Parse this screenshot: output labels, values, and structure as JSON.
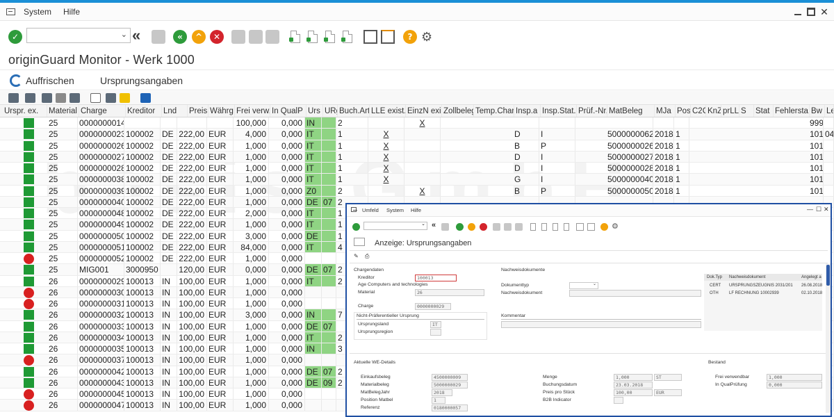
{
  "menu": {
    "items": [
      "System",
      "Hilfe"
    ]
  },
  "window": {
    "title": "originGuard Monitor - Werk 1000"
  },
  "app_toolbar": {
    "refresh_label": "Auffrischen",
    "origin_label": "Ursprungsangaben"
  },
  "columns": [
    "Urspr. ex.",
    "Material",
    "Charge",
    "Kreditor",
    "Lnd",
    "Preis",
    "Währg",
    "Frei verw.",
    "In QualP",
    "Urs",
    "URg",
    "Buch.Art",
    "LLE exist.",
    "EinzN exi.",
    "Zollbeleg",
    "Temp.Char",
    "Insp.a",
    "Insp.Stat.",
    "Prüf.-Nr.",
    "MatBeleg",
    "MJa",
    "Pos",
    "C2C",
    "KnZ",
    "prLLE",
    "S",
    "Stat",
    "Fehlersta.",
    "Bw",
    "Le"
  ],
  "rows": [
    {
      "st": "ok",
      "mat": "25",
      "ch": "0000000014",
      "kr": "",
      "lnd": "",
      "preis": "",
      "wg": "",
      "frei": "100,000",
      "qual": "0,000",
      "urs": "IN",
      "urg": "",
      "ba": "2",
      "lle": "",
      "ez": "X",
      "ia": "",
      "is": "",
      "mb": "",
      "mja": "",
      "pos": "",
      "bw": "999",
      "le": ""
    },
    {
      "st": "ok",
      "mat": "25",
      "ch": "0000000023",
      "kr": "100002",
      "lnd": "DE",
      "preis": "222,00",
      "wg": "EUR",
      "frei": "4,000",
      "qual": "0,000",
      "urs": "IT",
      "urg": "",
      "ba": "1",
      "lle": "X",
      "ez": "",
      "ia": "D",
      "is": "I",
      "mb": "5000000062",
      "mja": "2018",
      "pos": "1",
      "bw": "101",
      "le": "04"
    },
    {
      "st": "ok",
      "mat": "25",
      "ch": "0000000026",
      "kr": "100002",
      "lnd": "DE",
      "preis": "222,00",
      "wg": "EUR",
      "frei": "1,000",
      "qual": "0,000",
      "urs": "IT",
      "urg": "",
      "ba": "1",
      "lle": "X",
      "ez": "",
      "ia": "B",
      "is": "P",
      "mb": "5000000026",
      "mja": "2018",
      "pos": "1",
      "bw": "101",
      "le": ""
    },
    {
      "st": "ok",
      "mat": "25",
      "ch": "0000000027",
      "kr": "100002",
      "lnd": "DE",
      "preis": "222,00",
      "wg": "EUR",
      "frei": "1,000",
      "qual": "0,000",
      "urs": "IT",
      "urg": "",
      "ba": "1",
      "lle": "X",
      "ez": "",
      "ia": "D",
      "is": "I",
      "mb": "5000000027",
      "mja": "2018",
      "pos": "1",
      "bw": "101",
      "le": ""
    },
    {
      "st": "ok",
      "mat": "25",
      "ch": "0000000028",
      "kr": "100002",
      "lnd": "DE",
      "preis": "222,00",
      "wg": "EUR",
      "frei": "1,000",
      "qual": "0,000",
      "urs": "IT",
      "urg": "",
      "ba": "1",
      "lle": "X",
      "ez": "",
      "ia": "D",
      "is": "I",
      "mb": "5000000028",
      "mja": "2018",
      "pos": "1",
      "bw": "101",
      "le": ""
    },
    {
      "st": "ok",
      "mat": "25",
      "ch": "0000000038",
      "kr": "100002",
      "lnd": "DE",
      "preis": "222,00",
      "wg": "EUR",
      "frei": "1,000",
      "qual": "0,000",
      "urs": "IT",
      "urg": "",
      "ba": "1",
      "lle": "X",
      "ez": "",
      "ia": "G",
      "is": "I",
      "mb": "5000000040",
      "mja": "2018",
      "pos": "1",
      "bw": "101",
      "le": ""
    },
    {
      "st": "ok",
      "mat": "25",
      "ch": "0000000039",
      "kr": "100002",
      "lnd": "DE",
      "preis": "222,00",
      "wg": "EUR",
      "frei": "1,000",
      "qual": "0,000",
      "urs": "Z0",
      "urg": "",
      "ba": "2",
      "lle": "",
      "ez": "X",
      "ia": "B",
      "is": "P",
      "mb": "5000000050",
      "mja": "2018",
      "pos": "1",
      "bw": "101",
      "le": ""
    },
    {
      "st": "ok",
      "mat": "25",
      "ch": "0000000040",
      "kr": "100002",
      "lnd": "DE",
      "preis": "222,00",
      "wg": "EUR",
      "frei": "1,000",
      "qual": "0,000",
      "urs": "DE",
      "urg": "07",
      "ba": "2",
      "lle": "",
      "ez": "",
      "ia": "",
      "is": "",
      "mb": "",
      "mja": "",
      "pos": "",
      "bw": "",
      "le": ""
    },
    {
      "st": "ok",
      "mat": "25",
      "ch": "0000000048",
      "kr": "100002",
      "lnd": "DE",
      "preis": "222,00",
      "wg": "EUR",
      "frei": "2,000",
      "qual": "0,000",
      "urs": "IT",
      "urg": "",
      "ba": "1",
      "lle": "",
      "ez": "",
      "ia": "",
      "is": "",
      "mb": "",
      "mja": "",
      "pos": "",
      "bw": "",
      "le": ""
    },
    {
      "st": "ok",
      "mat": "25",
      "ch": "0000000049",
      "kr": "100002",
      "lnd": "DE",
      "preis": "222,00",
      "wg": "EUR",
      "frei": "1,000",
      "qual": "0,000",
      "urs": "IT",
      "urg": "",
      "ba": "1",
      "lle": "",
      "ez": "",
      "ia": "",
      "is": "",
      "mb": "",
      "mja": "",
      "pos": "",
      "bw": "",
      "le": ""
    },
    {
      "st": "ok",
      "mat": "25",
      "ch": "0000000050",
      "kr": "100002",
      "lnd": "DE",
      "preis": "222,00",
      "wg": "EUR",
      "frei": "3,000",
      "qual": "0,000",
      "urs": "DE",
      "urg": "",
      "ba": "1",
      "lle": "",
      "ez": "",
      "ia": "",
      "is": "",
      "mb": "",
      "mja": "",
      "pos": "",
      "bw": "",
      "le": ""
    },
    {
      "st": "ok",
      "mat": "25",
      "ch": "0000000051",
      "kr": "100002",
      "lnd": "DE",
      "preis": "222,00",
      "wg": "EUR",
      "frei": "84,000",
      "qual": "0,000",
      "urs": "IT",
      "urg": "",
      "ba": "4",
      "lle": "",
      "ez": "",
      "ia": "",
      "is": "",
      "mb": "",
      "mja": "",
      "pos": "",
      "bw": "",
      "le": ""
    },
    {
      "st": "err",
      "mat": "25",
      "ch": "0000000052",
      "kr": "100002",
      "lnd": "DE",
      "preis": "222,00",
      "wg": "EUR",
      "frei": "1,000",
      "qual": "0,000",
      "urs": "",
      "urg": "",
      "ba": "",
      "lle": "",
      "ez": "",
      "ia": "",
      "is": "",
      "mb": "",
      "mja": "",
      "pos": "",
      "bw": "",
      "le": ""
    },
    {
      "st": "ok",
      "mat": "25",
      "ch": "MIG001",
      "kr": "3000950",
      "lnd": "",
      "preis": "120,00",
      "wg": "EUR",
      "frei": "0,000",
      "qual": "0,000",
      "urs": "DE",
      "urg": "07",
      "ba": "2",
      "lle": "",
      "ez": "",
      "ia": "",
      "is": "",
      "mb": "",
      "mja": "",
      "pos": "",
      "bw": "",
      "le": ""
    },
    {
      "st": "ok",
      "mat": "26",
      "ch": "0000000029",
      "kr": "100013",
      "lnd": "IN",
      "preis": "100,00",
      "wg": "EUR",
      "frei": "1,000",
      "qual": "0,000",
      "urs": "IT",
      "urg": "",
      "ba": "2",
      "lle": "",
      "ez": "",
      "ia": "",
      "is": "",
      "mb": "",
      "mja": "",
      "pos": "",
      "bw": "",
      "le": ""
    },
    {
      "st": "err",
      "mat": "26",
      "ch": "0000000030",
      "kr": "100013",
      "lnd": "IN",
      "preis": "100,00",
      "wg": "EUR",
      "frei": "1,000",
      "qual": "0,000",
      "urs": "",
      "urg": "",
      "ba": "",
      "lle": "",
      "ez": "",
      "ia": "",
      "is": "",
      "mb": "",
      "mja": "",
      "pos": "",
      "bw": "",
      "le": ""
    },
    {
      "st": "err",
      "mat": "26",
      "ch": "0000000031",
      "kr": "100013",
      "lnd": "IN",
      "preis": "100,00",
      "wg": "EUR",
      "frei": "1,000",
      "qual": "0,000",
      "urs": "",
      "urg": "",
      "ba": "",
      "lle": "",
      "ez": "",
      "ia": "",
      "is": "",
      "mb": "",
      "mja": "",
      "pos": "",
      "bw": "",
      "le": ""
    },
    {
      "st": "ok",
      "mat": "26",
      "ch": "0000000032",
      "kr": "100013",
      "lnd": "IN",
      "preis": "100,00",
      "wg": "EUR",
      "frei": "3,000",
      "qual": "0,000",
      "urs": "IN",
      "urg": "",
      "ba": "7",
      "lle": "",
      "ez": "",
      "ia": "",
      "is": "",
      "mb": "",
      "mja": "",
      "pos": "",
      "bw": "",
      "le": ""
    },
    {
      "st": "ok",
      "mat": "26",
      "ch": "0000000033",
      "kr": "100013",
      "lnd": "IN",
      "preis": "100,00",
      "wg": "EUR",
      "frei": "1,000",
      "qual": "0,000",
      "urs": "DE",
      "urg": "07",
      "ba": "",
      "lle": "",
      "ez": "",
      "ia": "",
      "is": "",
      "mb": "",
      "mja": "",
      "pos": "",
      "bw": "",
      "le": ""
    },
    {
      "st": "ok",
      "mat": "26",
      "ch": "0000000034",
      "kr": "100013",
      "lnd": "IN",
      "preis": "100,00",
      "wg": "EUR",
      "frei": "1,000",
      "qual": "0,000",
      "urs": "IT",
      "urg": "",
      "ba": "2",
      "lle": "",
      "ez": "",
      "ia": "",
      "is": "",
      "mb": "",
      "mja": "",
      "pos": "",
      "bw": "",
      "le": ""
    },
    {
      "st": "ok",
      "mat": "26",
      "ch": "0000000035",
      "kr": "100013",
      "lnd": "IN",
      "preis": "100,00",
      "wg": "EUR",
      "frei": "1,000",
      "qual": "0,000",
      "urs": "IN",
      "urg": "",
      "ba": "3",
      "lle": "",
      "ez": "",
      "ia": "",
      "is": "",
      "mb": "",
      "mja": "",
      "pos": "",
      "bw": "",
      "le": ""
    },
    {
      "st": "err",
      "mat": "26",
      "ch": "0000000037",
      "kr": "100013",
      "lnd": "IN",
      "preis": "100,00",
      "wg": "EUR",
      "frei": "1,000",
      "qual": "0,000",
      "urs": "",
      "urg": "",
      "ba": "",
      "lle": "",
      "ez": "",
      "ia": "",
      "is": "",
      "mb": "",
      "mja": "",
      "pos": "",
      "bw": "",
      "le": ""
    },
    {
      "st": "ok",
      "mat": "26",
      "ch": "0000000042",
      "kr": "100013",
      "lnd": "IN",
      "preis": "100,00",
      "wg": "EUR",
      "frei": "1,000",
      "qual": "0,000",
      "urs": "DE",
      "urg": "07",
      "ba": "2",
      "lle": "",
      "ez": "",
      "ia": "",
      "is": "",
      "mb": "",
      "mja": "",
      "pos": "",
      "bw": "",
      "le": ""
    },
    {
      "st": "ok",
      "mat": "26",
      "ch": "0000000043",
      "kr": "100013",
      "lnd": "IN",
      "preis": "100,00",
      "wg": "EUR",
      "frei": "1,000",
      "qual": "0,000",
      "urs": "DE",
      "urg": "09",
      "ba": "2",
      "lle": "",
      "ez": "",
      "ia": "",
      "is": "",
      "mb": "",
      "mja": "",
      "pos": "",
      "bw": "",
      "le": ""
    },
    {
      "st": "err",
      "mat": "26",
      "ch": "0000000045",
      "kr": "100013",
      "lnd": "IN",
      "preis": "100,00",
      "wg": "EUR",
      "frei": "1,000",
      "qual": "0,000",
      "urs": "",
      "urg": "",
      "ba": "",
      "lle": "",
      "ez": "",
      "ia": "",
      "is": "",
      "mb": "",
      "mja": "",
      "pos": "",
      "bw": "",
      "le": ""
    },
    {
      "st": "err",
      "mat": "26",
      "ch": "0000000047",
      "kr": "100013",
      "lnd": "IN",
      "preis": "100,00",
      "wg": "EUR",
      "frei": "1,000",
      "qual": "0,000",
      "urs": "",
      "urg": "",
      "ba": "",
      "lle": "",
      "ez": "",
      "ia": "",
      "is": "",
      "mb": "",
      "mja": "",
      "pos": "",
      "bw": "",
      "le": ""
    }
  ],
  "popup": {
    "menu": [
      "Umfeld",
      "System",
      "Hilfe"
    ],
    "title": "Anzeige: Ursprungsangaben",
    "chargendaten": {
      "heading": "Chargendaten",
      "kreditor_label": "Kreditor",
      "kreditor_value": "100013",
      "kreditor_name": "Age Computers and technologies",
      "material_label": "Material",
      "material_value": "26",
      "charge_label": "Charge",
      "charge_value": "0000000029"
    },
    "ursprung": {
      "heading": "Nicht-Präferentieller Ursprung",
      "land_label": "Ursprungsland",
      "land_value": "IT",
      "region_label": "Ursprungsregion"
    },
    "nachweis": {
      "heading": "Nachweisdokumente",
      "doktyp_label": "Dokumenttyp",
      "dok_label": "Nachweisdokument",
      "kommentar_label": "Kommentar"
    },
    "doc_table": {
      "headers": [
        "Dok.Typ",
        "Nachweisdokument",
        "Angelegt a"
      ],
      "rows": [
        [
          "CERT",
          "URSPRUNGSZEUGNIS 2031/201",
          "26.08.2018"
        ],
        [
          "OTH",
          "LF RECHNUNG 10002939",
          "02.10.2018"
        ]
      ]
    },
    "we": {
      "heading": "Aktuelle WE-Details",
      "einkaufsbeleg_label": "Einkaufsbeleg",
      "einkaufsbeleg": "4500000009",
      "materialbeleg_label": "Materialbeleg",
      "materialbeleg": "5000000029",
      "matbelegjahr_label": "MatBelegJahr",
      "matbelegjahr": "2018",
      "position_label": "Position Matbel",
      "position": "1",
      "referenz_label": "Referenz",
      "referenz": "0180000057",
      "menge_label": "Menge",
      "menge": "1,000",
      "menge_unit": "ST",
      "buchungsdatum_label": "Buchungsdatum",
      "buchungsdatum": "23.03.2018",
      "preis_label": "Preis pro Stück",
      "preis": "100,00",
      "preis_unit": "EUR",
      "b2b_label": "B2B Indicator"
    },
    "bestand": {
      "heading": "Bestand",
      "frei_label": "Frei verwendbar",
      "frei": "1,000",
      "qual_label": "In QualPrüfung",
      "qual": "0,000"
    }
  }
}
